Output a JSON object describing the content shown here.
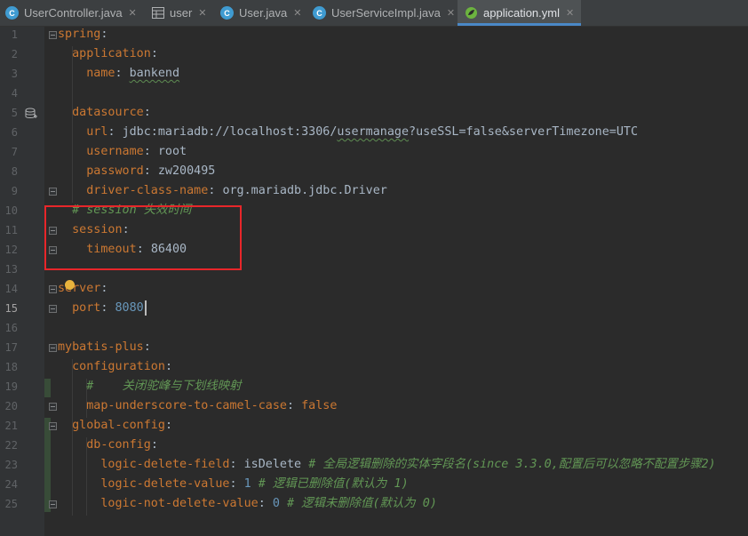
{
  "tabs": [
    {
      "label": "UserController.java",
      "icon": "java-class-icon",
      "active": false
    },
    {
      "label": "user",
      "icon": "table-icon",
      "active": false
    },
    {
      "label": "User.java",
      "icon": "java-class-icon",
      "active": false
    },
    {
      "label": "UserServiceImpl.java",
      "icon": "java-class-icon",
      "active": false
    },
    {
      "label": "application.yml",
      "icon": "spring-yaml-icon",
      "active": true
    }
  ],
  "editor": {
    "current_line": 15,
    "line_numbers": [
      "1",
      "2",
      "3",
      "4",
      "5",
      "6",
      "7",
      "8",
      "9",
      "10",
      "11",
      "12",
      "13",
      "14",
      "15",
      "16",
      "17",
      "18",
      "19",
      "20",
      "21",
      "22",
      "23",
      "24",
      "25"
    ],
    "lines": {
      "l1": {
        "key": "spring"
      },
      "l2": {
        "key": "application"
      },
      "l3": {
        "key": "name",
        "value": "bankend"
      },
      "l5": {
        "key": "datasource"
      },
      "l6": {
        "key": "url",
        "v1": "jdbc:mariadb://localhost:3306/",
        "v2": "usermanage",
        "v3": "?useSSL=false&serverTimezone=UTC"
      },
      "l7": {
        "key": "username",
        "value": "root"
      },
      "l8": {
        "key": "password",
        "value": "zw200495"
      },
      "l9": {
        "key": "driver-class-name",
        "value": "org.mariadb.jdbc.Driver"
      },
      "l10": {
        "comment": "# session 失效时间"
      },
      "l11": {
        "key": "session"
      },
      "l12": {
        "key": "timeout",
        "value": "86400"
      },
      "l14": {
        "key": "server"
      },
      "l15": {
        "key": "port",
        "value": "8080"
      },
      "l17": {
        "key": "mybatis-plus"
      },
      "l18": {
        "key": "configuration"
      },
      "l19": {
        "comment": "#    关闭驼峰与下划线映射"
      },
      "l20": {
        "key": "map-underscore-to-camel-case",
        "value": "false"
      },
      "l21": {
        "key": "global-config"
      },
      "l22": {
        "key": "db-config"
      },
      "l23": {
        "key": "logic-delete-field",
        "value": "isDelete",
        "comment": "# 全局逻辑删除的实体字段名(since 3.3.0,配置后可以忽略不配置步骤2)"
      },
      "l24": {
        "key": "logic-delete-value",
        "value": "1",
        "comment": "# 逻辑已删除值(默认为 1)"
      },
      "l25": {
        "key": "logic-not-delete-value",
        "value": "0",
        "comment": "# 逻辑未删除值(默认为 0)"
      }
    }
  },
  "colors": {
    "background": "#2b2b2b",
    "key": "#cc7832",
    "number": "#6897bb",
    "comment": "#629755",
    "highlight_box": "#e8262a"
  }
}
